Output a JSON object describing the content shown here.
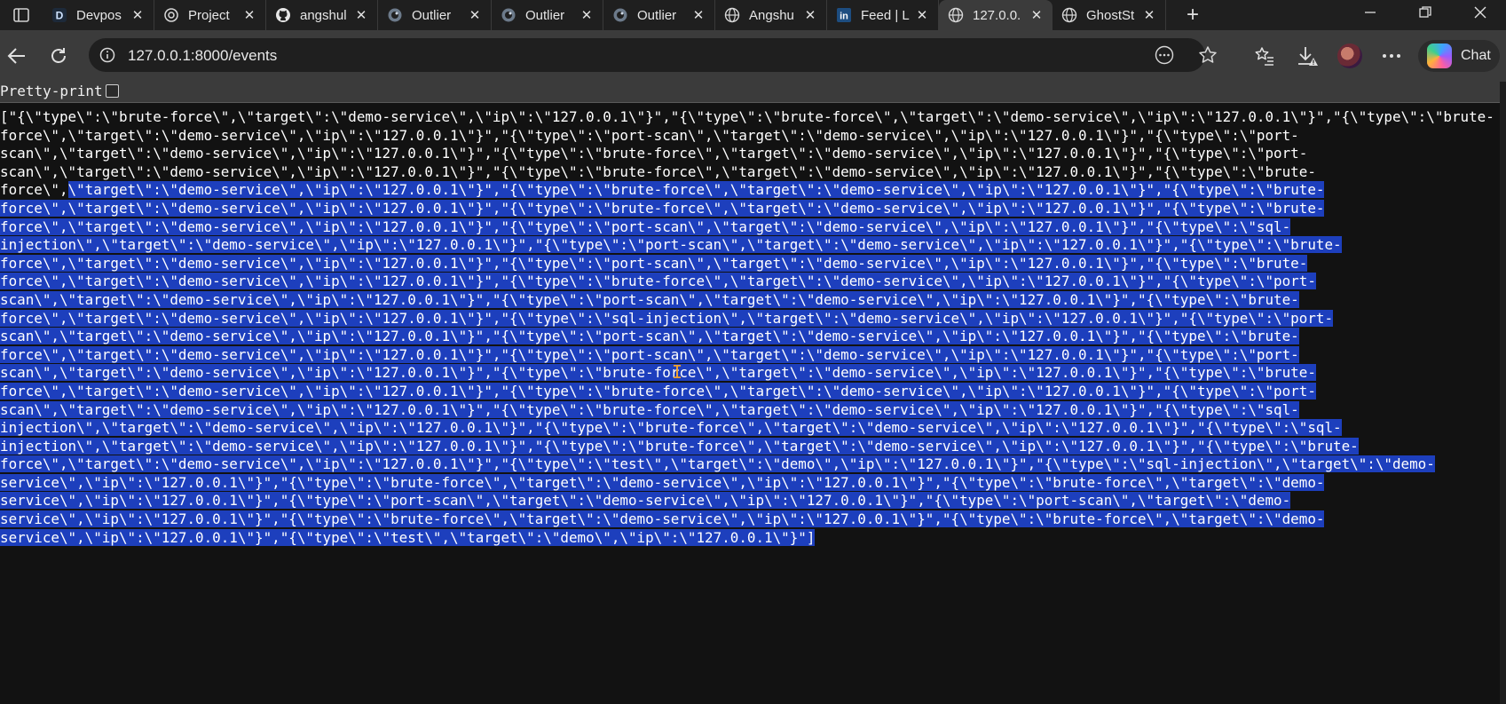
{
  "tabs": [
    {
      "name": "tab-devpost",
      "title": "Devpos",
      "favicon": "devpost-icon"
    },
    {
      "name": "tab-project",
      "title": "Project",
      "favicon": "openai-icon"
    },
    {
      "name": "tab-github",
      "title": "angshul",
      "favicon": "github-icon"
    },
    {
      "name": "tab-outlier-1",
      "title": "Outlier",
      "favicon": "outlier-icon"
    },
    {
      "name": "tab-outlier-2",
      "title": "Outlier",
      "favicon": "outlier-icon"
    },
    {
      "name": "tab-outlier-3",
      "title": "Outlier",
      "favicon": "outlier-icon"
    },
    {
      "name": "tab-angshu",
      "title": "Angshu",
      "favicon": "globe-icon"
    },
    {
      "name": "tab-linkedin",
      "title": "Feed | L",
      "favicon": "linkedin-icon"
    },
    {
      "name": "tab-localhost",
      "title": "127.0.0.",
      "favicon": "globe-icon",
      "active": true
    },
    {
      "name": "tab-ghost",
      "title": "GhostSt",
      "favicon": "globe-icon"
    }
  ],
  "address_bar": {
    "url": "127.0.0.1:8000/events"
  },
  "toolbar": {
    "chat_label": "Chat"
  },
  "page": {
    "pretty_print_label": "Pretty-print",
    "json_lines": [
      {
        "plain": "[\"{\\\"type\\\":\\\"brute-force\\\",\\\"target\\\":\\\"demo-service\\\",\\\"ip\\\":\\\"127.0.0.1\\\"}\",\"{\\\"type\\\":\\\"brute-force\\\",\\\"target\\\":\\\"demo-service\\\",\\\"ip\\\":\\\"127.0.0.1\\\"}\",\"{\\\"type\\\":\\\"brute-",
        "sel": ""
      },
      {
        "plain": "force\\\",\\\"target\\\":\\\"demo-service\\\",\\\"ip\\\":\\\"127.0.0.1\\\"}\",\"{\\\"type\\\":\\\"port-scan\\\",\\\"target\\\":\\\"demo-service\\\",\\\"ip\\\":\\\"127.0.0.1\\\"}\",\"{\\\"type\\\":\\\"port-",
        "sel": ""
      },
      {
        "plain": "scan\\\",\\\"target\\\":\\\"demo-service\\\",\\\"ip\\\":\\\"127.0.0.1\\\"}\",\"{\\\"type\\\":\\\"brute-force\\\",\\\"target\\\":\\\"demo-service\\\",\\\"ip\\\":\\\"127.0.0.1\\\"}\",\"{\\\"type\\\":\\\"port-",
        "sel": ""
      },
      {
        "plain": "scan\\\",\\\"target\\\":\\\"demo-service\\\",\\\"ip\\\":\\\"127.0.0.1\\\"}\",\"{\\\"type\\\":\\\"brute-force\\\",\\\"target\\\":\\\"demo-service\\\",\\\"ip\\\":\\\"127.0.0.1\\\"}\",\"{\\\"type\\\":\\\"brute-",
        "sel": ""
      },
      {
        "plain": "force\\\",",
        "sel": "\\\"target\\\":\\\"demo-service\\\",\\\"ip\\\":\\\"127.0.0.1\\\"}\",\"{\\\"type\\\":\\\"brute-force\\\",\\\"target\\\":\\\"demo-service\\\",\\\"ip\\\":\\\"127.0.0.1\\\"}\",\"{\\\"type\\\":\\\"brute-"
      },
      {
        "plain": "",
        "sel": "force\\\",\\\"target\\\":\\\"demo-service\\\",\\\"ip\\\":\\\"127.0.0.1\\\"}\",\"{\\\"type\\\":\\\"brute-force\\\",\\\"target\\\":\\\"demo-service\\\",\\\"ip\\\":\\\"127.0.0.1\\\"}\",\"{\\\"type\\\":\\\"brute-"
      },
      {
        "plain": "",
        "sel": "force\\\",\\\"target\\\":\\\"demo-service\\\",\\\"ip\\\":\\\"127.0.0.1\\\"}\",\"{\\\"type\\\":\\\"port-scan\\\",\\\"target\\\":\\\"demo-service\\\",\\\"ip\\\":\\\"127.0.0.1\\\"}\",\"{\\\"type\\\":\\\"sql-"
      },
      {
        "plain": "",
        "sel": "injection\\\",\\\"target\\\":\\\"demo-service\\\",\\\"ip\\\":\\\"127.0.0.1\\\"}\",\"{\\\"type\\\":\\\"port-scan\\\",\\\"target\\\":\\\"demo-service\\\",\\\"ip\\\":\\\"127.0.0.1\\\"}\",\"{\\\"type\\\":\\\"brute-"
      },
      {
        "plain": "",
        "sel": "force\\\",\\\"target\\\":\\\"demo-service\\\",\\\"ip\\\":\\\"127.0.0.1\\\"}\",\"{\\\"type\\\":\\\"port-scan\\\",\\\"target\\\":\\\"demo-service\\\",\\\"ip\\\":\\\"127.0.0.1\\\"}\",\"{\\\"type\\\":\\\"brute-"
      },
      {
        "plain": "",
        "sel": "force\\\",\\\"target\\\":\\\"demo-service\\\",\\\"ip\\\":\\\"127.0.0.1\\\"}\",\"{\\\"type\\\":\\\"brute-force\\\",\\\"target\\\":\\\"demo-service\\\",\\\"ip\\\":\\\"127.0.0.1\\\"}\",\"{\\\"type\\\":\\\"port-"
      },
      {
        "plain": "",
        "sel": "scan\\\",\\\"target\\\":\\\"demo-service\\\",\\\"ip\\\":\\\"127.0.0.1\\\"}\",\"{\\\"type\\\":\\\"port-scan\\\",\\\"target\\\":\\\"demo-service\\\",\\\"ip\\\":\\\"127.0.0.1\\\"}\",\"{\\\"type\\\":\\\"brute-"
      },
      {
        "plain": "",
        "sel": "force\\\",\\\"target\\\":\\\"demo-service\\\",\\\"ip\\\":\\\"127.0.0.1\\\"}\",\"{\\\"type\\\":\\\"sql-injection\\\",\\\"target\\\":\\\"demo-service\\\",\\\"ip\\\":\\\"127.0.0.1\\\"}\",\"{\\\"type\\\":\\\"port-"
      },
      {
        "plain": "",
        "sel": "scan\\\",\\\"target\\\":\\\"demo-service\\\",\\\"ip\\\":\\\"127.0.0.1\\\"}\",\"{\\\"type\\\":\\\"port-scan\\\",\\\"target\\\":\\\"demo-service\\\",\\\"ip\\\":\\\"127.0.0.1\\\"}\",\"{\\\"type\\\":\\\"brute-"
      },
      {
        "plain": "",
        "sel": "force\\\",\\\"target\\\":\\\"demo-service\\\",\\\"ip\\\":\\\"127.0.0.1\\\"}\",\"{\\\"type\\\":\\\"port-scan\\\",\\\"target\\\":\\\"demo-service\\\",\\\"ip\\\":\\\"127.0.0.1\\\"}\",\"{\\\"type\\\":\\\"port-"
      },
      {
        "plain": "",
        "sel": "scan\\\",\\\"target\\\":\\\"demo-service\\\",\\\"ip\\\":\\\"127.0.0.1\\\"}\",\"{\\\"type\\\":\\\"brute-force\\\",\\\"target\\\":\\\"demo-service\\\",\\\"ip\\\":\\\"127.0.0.1\\\"}\",\"{\\\"type\\\":\\\"brute-"
      },
      {
        "plain": "",
        "sel": "force\\\",\\\"target\\\":\\\"demo-service\\\",\\\"ip\\\":\\\"127.0.0.1\\\"}\",\"{\\\"type\\\":\\\"brute-force\\\",\\\"target\\\":\\\"demo-service\\\",\\\"ip\\\":\\\"127.0.0.1\\\"}\",\"{\\\"type\\\":\\\"port-"
      },
      {
        "plain": "",
        "sel": "scan\\\",\\\"target\\\":\\\"demo-service\\\",\\\"ip\\\":\\\"127.0.0.1\\\"}\",\"{\\\"type\\\":\\\"brute-force\\\",\\\"target\\\":\\\"demo-service\\\",\\\"ip\\\":\\\"127.0.0.1\\\"}\",\"{\\\"type\\\":\\\"sql-"
      },
      {
        "plain": "",
        "sel": "injection\\\",\\\"target\\\":\\\"demo-service\\\",\\\"ip\\\":\\\"127.0.0.1\\\"}\",\"{\\\"type\\\":\\\"brute-force\\\",\\\"target\\\":\\\"demo-service\\\",\\\"ip\\\":\\\"127.0.0.1\\\"}\",\"{\\\"type\\\":\\\"sql-"
      },
      {
        "plain": "",
        "sel": "injection\\\",\\\"target\\\":\\\"demo-service\\\",\\\"ip\\\":\\\"127.0.0.1\\\"}\",\"{\\\"type\\\":\\\"brute-force\\\",\\\"target\\\":\\\"demo-service\\\",\\\"ip\\\":\\\"127.0.0.1\\\"}\",\"{\\\"type\\\":\\\"brute-"
      },
      {
        "plain": "",
        "sel": "force\\\",\\\"target\\\":\\\"demo-service\\\",\\\"ip\\\":\\\"127.0.0.1\\\"}\",\"{\\\"type\\\":\\\"test\\\",\\\"target\\\":\\\"demo\\\",\\\"ip\\\":\\\"127.0.0.1\\\"}\",\"{\\\"type\\\":\\\"sql-injection\\\",\\\"target\\\":\\\"demo-"
      },
      {
        "plain": "",
        "sel": "service\\\",\\\"ip\\\":\\\"127.0.0.1\\\"}\",\"{\\\"type\\\":\\\"brute-force\\\",\\\"target\\\":\\\"demo-service\\\",\\\"ip\\\":\\\"127.0.0.1\\\"}\",\"{\\\"type\\\":\\\"brute-force\\\",\\\"target\\\":\\\"demo-"
      },
      {
        "plain": "",
        "sel": "service\\\",\\\"ip\\\":\\\"127.0.0.1\\\"}\",\"{\\\"type\\\":\\\"port-scan\\\",\\\"target\\\":\\\"demo-service\\\",\\\"ip\\\":\\\"127.0.0.1\\\"}\",\"{\\\"type\\\":\\\"port-scan\\\",\\\"target\\\":\\\"demo-"
      },
      {
        "plain": "",
        "sel": "service\\\",\\\"ip\\\":\\\"127.0.0.1\\\"}\",\"{\\\"type\\\":\\\"brute-force\\\",\\\"target\\\":\\\"demo-service\\\",\\\"ip\\\":\\\"127.0.0.1\\\"}\",\"{\\\"type\\\":\\\"brute-force\\\",\\\"target\\\":\\\"demo-"
      },
      {
        "plain": "",
        "sel": "service\\\",\\\"ip\\\":\\\"127.0.0.1\\\"}\",\"{\\\"type\\\":\\\"test\\\",\\\"target\\\":\\\"demo\\\",\\\"ip\\\":\\\"127.0.0.1\\\"}\"]"
      }
    ]
  },
  "colors": {
    "tabstrip_bg": "#1f1f1f",
    "toolbar_bg": "#3b3b3b",
    "page_bg": "#121212",
    "selection_bg": "#1d3fbd",
    "text": "#ffffff"
  }
}
